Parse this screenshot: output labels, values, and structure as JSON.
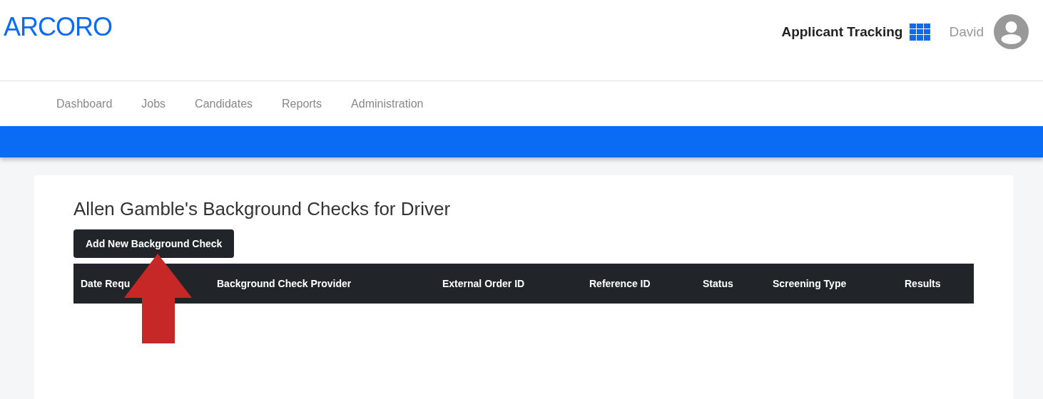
{
  "header": {
    "logo": "ARCORO",
    "app_name": "Applicant Tracking",
    "user_name": "David"
  },
  "nav": {
    "items": [
      {
        "label": "Dashboard",
        "selected": false
      },
      {
        "label": "Jobs",
        "selected": false
      },
      {
        "label": "Candidates",
        "selected": false
      },
      {
        "label": "Reports",
        "selected": false
      },
      {
        "label": "Administration",
        "selected": false
      }
    ]
  },
  "page": {
    "title": "Allen Gamble's Background Checks for Driver",
    "add_button": "Add New Background Check"
  },
  "table": {
    "columns": [
      "Date Requ",
      "Background Check Provider",
      "External Order ID",
      "Reference ID",
      "Status",
      "Screening Type",
      "Results"
    ]
  }
}
